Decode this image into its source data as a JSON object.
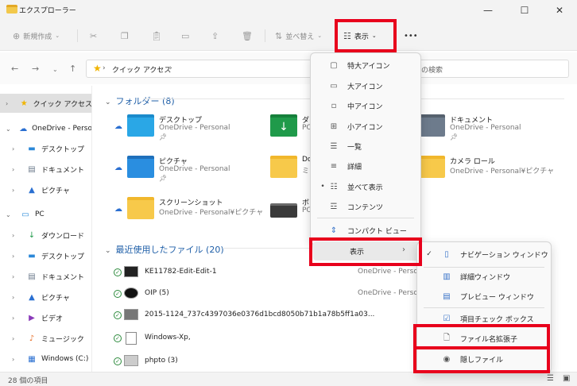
{
  "window": {
    "title": "エクスプローラー",
    "minimize": "—",
    "maximize": "☐",
    "close": "✕"
  },
  "toolbar": {
    "new_label": "新規作成",
    "sort_label": "並べ替え",
    "view_label": "表示",
    "more_label": "•••"
  },
  "address": {
    "path": "クイック アクセス",
    "search_placeholder": "スの検索"
  },
  "sidebar": {
    "items": [
      {
        "label": "クイック アクセス",
        "icon": "star-icon"
      },
      {
        "label": "OneDrive - Perso",
        "icon": "cloud-icon"
      },
      {
        "label": "デスクトップ",
        "icon": "desktop-icon"
      },
      {
        "label": "ドキュメント",
        "icon": "document-icon"
      },
      {
        "label": "ピクチャ",
        "icon": "picture-icon"
      },
      {
        "label": "PC",
        "icon": "pc-icon"
      },
      {
        "label": "ダウンロード",
        "icon": "download-icon"
      },
      {
        "label": "デスクトップ",
        "icon": "desktop-icon"
      },
      {
        "label": "ドキュメント",
        "icon": "document-icon"
      },
      {
        "label": "ピクチャ",
        "icon": "picture-icon"
      },
      {
        "label": "ビデオ",
        "icon": "video-icon"
      },
      {
        "label": "ミュージック",
        "icon": "music-icon"
      },
      {
        "label": "Windows (C:)",
        "icon": "drive-icon"
      }
    ]
  },
  "folders_section": {
    "title": "フォルダー (8)",
    "items": [
      {
        "name": "デスクトップ",
        "sub": "OneDrive - Personal",
        "icon": "desktop-folder-icon"
      },
      {
        "name": "ダ",
        "sub": "PC",
        "icon": "download-folder-icon"
      },
      {
        "name": "ドキュメント",
        "sub": "OneDrive - Personal",
        "icon": "document-folder-icon"
      },
      {
        "name": "ピクチャ",
        "sub": "OneDrive - Personal",
        "icon": "picture-folder-icon"
      },
      {
        "name": "Do",
        "sub": "ミ",
        "icon": "folder-icon"
      },
      {
        "name": "カメラ ロール",
        "sub": "OneDrive - Personal¥ピクチャ",
        "icon": "folder-icon"
      },
      {
        "name": "スクリーンショット",
        "sub": "OneDrive - Personal¥ピクチャ",
        "icon": "folder-icon"
      },
      {
        "name": "ボ",
        "sub": "PC",
        "icon": "drive-icon"
      }
    ]
  },
  "recent_section": {
    "title": "最近使用したファイル (20)",
    "items": [
      {
        "name": "KE11782-Edit-Edit-1",
        "location": "OneDrive - Perso"
      },
      {
        "name": "OIP (5)",
        "location": "OneDrive - Perso"
      },
      {
        "name": "2015-1124_737c4397036e0376d1bcd8050b71b1a78b5ff1a03...",
        "location": ""
      },
      {
        "name": "Windows-Xp,",
        "location": ""
      },
      {
        "name": "phpto (3)",
        "location": ""
      }
    ]
  },
  "status": {
    "count": "28 個の項目"
  },
  "view_menu": {
    "items": [
      {
        "label": "特大アイコン",
        "icon": "extra-large-icons-icon",
        "selected": false
      },
      {
        "label": "大アイコン",
        "icon": "large-icons-icon",
        "selected": false
      },
      {
        "label": "中アイコン",
        "icon": "medium-icons-icon",
        "selected": false
      },
      {
        "label": "小アイコン",
        "icon": "small-icons-icon",
        "selected": false
      },
      {
        "label": "一覧",
        "icon": "list-icon",
        "selected": false
      },
      {
        "label": "詳細",
        "icon": "details-icon",
        "selected": false
      },
      {
        "label": "並べて表示",
        "icon": "tiles-icon",
        "selected": true
      },
      {
        "label": "コンテンツ",
        "icon": "content-icon",
        "selected": false
      },
      {
        "label": "コンパクト ビュー",
        "icon": "compact-view-icon",
        "selected": false
      }
    ],
    "show_label": "表示"
  },
  "show_submenu": {
    "items": [
      {
        "label": "ナビゲーション ウィンドウ",
        "checked": true
      },
      {
        "label": "詳細ウィンドウ",
        "checked": false
      },
      {
        "label": "プレビュー ウィンドウ",
        "checked": false
      },
      {
        "label": "項目チェック ボックス",
        "checked": false
      },
      {
        "label": "ファイル名拡張子",
        "checked": false
      },
      {
        "label": "隠しファイル",
        "checked": false
      }
    ]
  },
  "colors": {
    "highlight_red": "#e8001c",
    "accent_blue": "#1f5fa8"
  }
}
